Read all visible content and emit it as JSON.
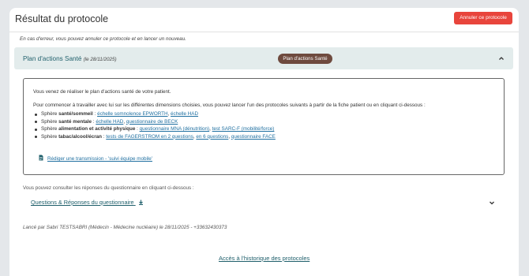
{
  "header": {
    "title": "Résultat du protocole",
    "cancel_label": "Annuler ce protocole"
  },
  "note": "En cas d'erreur, vous pouvez annuler ce protocole et en lancer un nouveau.",
  "accordion": {
    "title": "Plan d'actions Santé",
    "date": "(le 28/11/2025)",
    "badge": "Plan d'actions Santé",
    "icon": "chevron-up-icon"
  },
  "panel": {
    "intro": "Vous venez de réaliser le plan d'actions santé de votre patient.",
    "start": "Pour commencer à travailler avec lui sur les différentes dimensions choisies, vous pouvez lancer l'un des protocoles suivants à partir de la fiche patient ou en cliquant ci-dessous :",
    "spheres": [
      {
        "prefix": "Sphère ",
        "name": "santé/sommeil",
        "sep": " : ",
        "links": [
          "échelle somnolence EPWORTH",
          "échelle HAD"
        ]
      },
      {
        "prefix": "Sphère ",
        "name": "santé mentale",
        "sep": " : ",
        "links": [
          "échelle HAD",
          "questionnaire de BECK"
        ]
      },
      {
        "prefix": "Sphère ",
        "name": "alimentation et activité physique",
        "sep": " : ",
        "links": [
          "questionnaire MNA (dénutrition)",
          "test SARC-F (mobilité/force)"
        ]
      },
      {
        "prefix": "Sphère ",
        "name": "tabac/alcool/écran",
        "sep": " : ",
        "links": [
          "tests de FAGERSTROM en 2 questions",
          "en 6 questions",
          "questionnaire FACE"
        ]
      }
    ],
    "link_separator": ", ",
    "transmission_label": "Rédiger une transmission - 'suivi équipe mobile'",
    "transmission_icon": "document-icon"
  },
  "consult_text": "Vous pouvez consulter les réponses du questionnaire en cliquant ci-dessous :",
  "qa": {
    "label": "Questions & Réponses du questionnaire",
    "icon": "download-icon",
    "toggle_icon": "chevron-down-icon"
  },
  "launched_by": "Lancé par Sabri TESTSABRI (Médecin - Médecine nucléaire) le 28/11/2025 - +33632430373",
  "history_link": "Accès à l'historique des protocoles",
  "colors": {
    "danger": "#e8453c",
    "accent": "#1f5f6b",
    "link": "#1f6fa0",
    "badge": "#6e4a3e",
    "accordion_bg": "#e3ecec"
  }
}
